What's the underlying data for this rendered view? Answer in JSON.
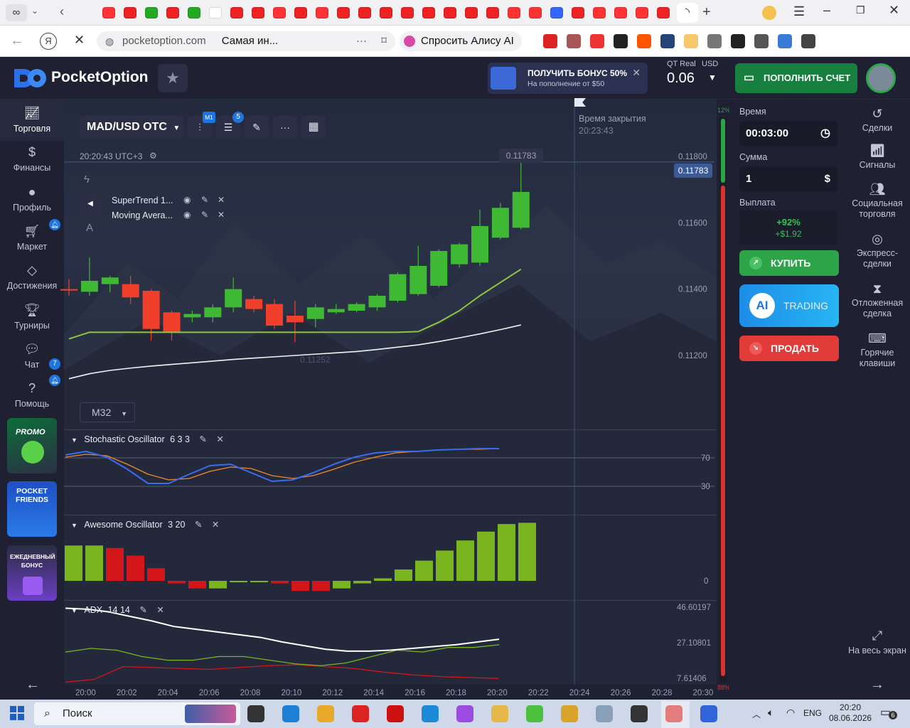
{
  "browser": {
    "url_text": "pocketoption.com",
    "tab_title": "Самая ин...",
    "alice_label": "Спросить Алису AI",
    "tabs_count": 31
  },
  "app": {
    "logo_text": "PocketOption",
    "bonus": {
      "title": "ПОЛУЧИТЬ БОНУС 50%",
      "subtitle": "На пополнение от $50"
    },
    "account": {
      "type": "QT Real",
      "currency": "USD",
      "balance": "0.06"
    },
    "deposit_label": "ПОПОЛНИТЬ СЧЕТ"
  },
  "left_nav": {
    "items": [
      {
        "label": "Торговля",
        "icon": "chart-icon"
      },
      {
        "label": "Финансы",
        "icon": "dollar-icon"
      },
      {
        "label": "Профиль",
        "icon": "user-icon"
      },
      {
        "label": "Маркет",
        "icon": "cart-icon"
      },
      {
        "label": "Достижения",
        "icon": "diamond-icon"
      },
      {
        "label": "Турниры",
        "icon": "trophy-icon"
      },
      {
        "label": "Чат",
        "icon": "chat-icon",
        "badge": "7"
      },
      {
        "label": "Помощь",
        "icon": "help-icon"
      }
    ],
    "promos": [
      "PROMO",
      "POCKET FRIENDS",
      "ЕЖЕДНЕВНЫЙ БОНУС"
    ]
  },
  "chart": {
    "pair": "MAD/USD OTC",
    "timeframe_badge": "M1",
    "indicators_badge": "5",
    "time_display": "20:20:43 UTC+3",
    "close_label": "Время закрытия",
    "close_time": "20:23:43",
    "current_price": "0.11783",
    "hover_price": "0.11783",
    "low_label": "0.11252",
    "timeframe_select": "M32",
    "progress_top": "12%",
    "progress_bottom": "88%",
    "indicators": [
      "SuperTrend 1...",
      "Moving Avera..."
    ],
    "osc1": {
      "name": "Stochastic Oscillator",
      "params": "6 3 3"
    },
    "osc2": {
      "name": "Awesome Oscillator",
      "params": "3 20"
    },
    "osc3": {
      "name": "ADX",
      "params": "14 14"
    }
  },
  "chart_data": {
    "type": "candlestick",
    "y_ticks": [
      "0.11800",
      "0.11600",
      "0.11400",
      "0.11200"
    ],
    "x_ticks": [
      "20:00",
      "20:02",
      "20:04",
      "20:06",
      "20:08",
      "20:10",
      "20:12",
      "20:14",
      "20:16",
      "20:18",
      "20:20",
      "20:22",
      "20:24",
      "20:26",
      "20:28",
      "20:30"
    ],
    "candles": [
      {
        "o": 0.114,
        "h": 0.1143,
        "l": 0.1138,
        "c": 0.11398,
        "up": false
      },
      {
        "o": 0.11392,
        "h": 0.11495,
        "l": 0.1138,
        "c": 0.11425,
        "up": true
      },
      {
        "o": 0.11415,
        "h": 0.1144,
        "l": 0.1139,
        "c": 0.11435,
        "up": true
      },
      {
        "o": 0.11415,
        "h": 0.1144,
        "l": 0.11355,
        "c": 0.11375,
        "up": false
      },
      {
        "o": 0.11395,
        "h": 0.114,
        "l": 0.11245,
        "c": 0.1128,
        "up": false
      },
      {
        "o": 0.1133,
        "h": 0.11335,
        "l": 0.11245,
        "c": 0.1127,
        "up": false
      },
      {
        "o": 0.11315,
        "h": 0.11335,
        "l": 0.113,
        "c": 0.11325,
        "up": true
      },
      {
        "o": 0.11315,
        "h": 0.11355,
        "l": 0.113,
        "c": 0.11345,
        "up": true
      },
      {
        "o": 0.11345,
        "h": 0.11435,
        "l": 0.1133,
        "c": 0.114,
        "up": true
      },
      {
        "o": 0.1137,
        "h": 0.1138,
        "l": 0.1133,
        "c": 0.1134,
        "up": false
      },
      {
        "o": 0.11355,
        "h": 0.1137,
        "l": 0.1128,
        "c": 0.1129,
        "up": false
      },
      {
        "o": 0.1132,
        "h": 0.11365,
        "l": 0.1124,
        "c": 0.113,
        "up": false
      },
      {
        "o": 0.1131,
        "h": 0.11355,
        "l": 0.11285,
        "c": 0.11345,
        "up": true
      },
      {
        "o": 0.1133,
        "h": 0.11355,
        "l": 0.11325,
        "c": 0.1134,
        "up": true
      },
      {
        "o": 0.11335,
        "h": 0.1136,
        "l": 0.1133,
        "c": 0.11355,
        "up": true
      },
      {
        "o": 0.11345,
        "h": 0.11385,
        "l": 0.11335,
        "c": 0.1138,
        "up": true
      },
      {
        "o": 0.11365,
        "h": 0.1145,
        "l": 0.1136,
        "c": 0.11445,
        "up": true
      },
      {
        "o": 0.11385,
        "h": 0.1153,
        "l": 0.1138,
        "c": 0.1147,
        "up": true
      },
      {
        "o": 0.1141,
        "h": 0.1152,
        "l": 0.11405,
        "c": 0.11515,
        "up": true
      },
      {
        "o": 0.11475,
        "h": 0.1154,
        "l": 0.11465,
        "c": 0.11535,
        "up": true
      },
      {
        "o": 0.1148,
        "h": 0.1164,
        "l": 0.1147,
        "c": 0.1159,
        "up": true
      },
      {
        "o": 0.11555,
        "h": 0.1166,
        "l": 0.1155,
        "c": 0.11645,
        "up": true
      },
      {
        "o": 0.11585,
        "h": 0.1179,
        "l": 0.1158,
        "c": 0.11693,
        "up": true
      }
    ],
    "supertrend": [
      0.1125,
      0.1127,
      0.1127,
      0.1127,
      0.1127,
      0.1127,
      0.1127,
      0.1127,
      0.1127,
      0.1127,
      0.1127,
      0.1127,
      0.1127,
      0.1127,
      0.1127,
      0.1127,
      0.1127,
      0.11272,
      0.113,
      0.11335,
      0.1138,
      0.1142,
      0.1146
    ],
    "moving_average": [
      0.1113,
      0.11145,
      0.11155,
      0.11162,
      0.11168,
      0.11173,
      0.11178,
      0.11183,
      0.11188,
      0.11192,
      0.11196,
      0.112,
      0.11204,
      0.11208,
      0.11212,
      0.11218,
      0.11225,
      0.11232,
      0.11242,
      0.11253,
      0.11265,
      0.11278,
      0.11292
    ],
    "stochastic": {
      "levels": [
        "70",
        "30"
      ],
      "k": [
        75,
        80,
        72,
        55,
        35,
        35,
        48,
        60,
        62,
        50,
        38,
        40,
        50,
        62,
        72,
        78,
        80,
        80,
        82,
        83,
        84,
        84
      ],
      "d": [
        72,
        76,
        74,
        62,
        48,
        40,
        42,
        52,
        58,
        56,
        46,
        42,
        46,
        55,
        65,
        72,
        78,
        80,
        82,
        83,
        83,
        84
      ]
    },
    "awesome": {
      "zero_label": "0",
      "values": [
        1.4,
        1.4,
        1.3,
        1.0,
        0.5,
        -0.1,
        -0.3,
        -0.3,
        -0.05,
        -0.05,
        -0.1,
        -0.4,
        -0.4,
        -0.3,
        -0.1,
        0.1,
        0.45,
        0.8,
        1.2,
        1.6,
        1.95,
        2.25,
        2.3
      ],
      "up": [
        true,
        true,
        false,
        false,
        false,
        false,
        false,
        true,
        true,
        true,
        false,
        false,
        false,
        true,
        true,
        true,
        true,
        true,
        true,
        true,
        true,
        true,
        true
      ]
    },
    "adx": {
      "y_ticks": [
        "46.60197",
        "27.10801",
        "7.61406"
      ],
      "adx": [
        46.0,
        45.5,
        44.0,
        41.5,
        39.0,
        36.0,
        34.5,
        33.0,
        31.5,
        30.0,
        27.5,
        25.5,
        23.5,
        22.5,
        22.5,
        23.0,
        24.0,
        25.0,
        26.0,
        27.5,
        29.0
      ],
      "plus_di": [
        22.0,
        24.0,
        23.0,
        19.5,
        17.5,
        17.5,
        19.5,
        19.5,
        17.5,
        15.5,
        14.5,
        16.0,
        19.5,
        23.0,
        22.0,
        24.5,
        24.5,
        26.0
      ],
      "minus_di": [
        5.5,
        7.0,
        14.0,
        13.5,
        13.0,
        12.5,
        13.5,
        14.5,
        15.0,
        14.0,
        13.0,
        11.0,
        9.5,
        8.5,
        8.0,
        7.5
      ]
    }
  },
  "trade_panel": {
    "time_label": "Время",
    "time_value": "00:03:00",
    "amount_label": "Сумма",
    "amount_value": "1",
    "payout_label": "Выплата",
    "payout_pct": "+92%",
    "payout_value": "+$1.92",
    "buy_label": "КУПИТЬ",
    "ai_label": "AI",
    "ai_trading": "TRADING",
    "sell_label": "ПРОДАТЬ"
  },
  "right_nav": {
    "items": [
      {
        "label": "Сделки",
        "icon": "history-icon"
      },
      {
        "label": "Сигналы",
        "icon": "signal-icon"
      },
      {
        "label": "Социальная торговля",
        "icon": "people-icon"
      },
      {
        "label": "Экспресс-сделки",
        "icon": "target-icon"
      },
      {
        "label": "Отложенная сделка",
        "icon": "hourglass-icon"
      },
      {
        "label": "Горячие клавиши",
        "icon": "keyboard-icon"
      }
    ],
    "fullscreen_label": "На весь экран"
  },
  "taskbar": {
    "search_placeholder": "Поиск",
    "lang": "ENG",
    "time": "20:20",
    "date": "08.06.2026",
    "notif": "6"
  }
}
